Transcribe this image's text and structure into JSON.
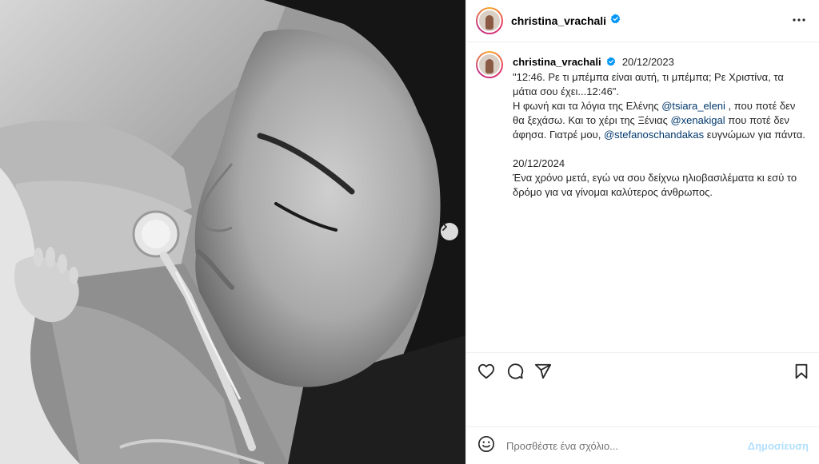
{
  "post": {
    "username": "christina_vrachali",
    "verified": true
  },
  "caption": {
    "username": "christina_vrachali",
    "date": "20/12/2023",
    "line1": "\"12:46. Ρε τι μπέμπα είναι αυτή, τι μπέμπα; Ρε Χριστίνα, τα μάτια σου έχει...12:46\".",
    "line2_pre": "Η φωνή και τα λόγια της Ελένης ",
    "mention1": "@tsiara_eleni",
    "line2_post": " , που ποτέ δεν θα  ξεχάσω. Και το χέρι της Ξένιας ",
    "mention2": "@xenakigal",
    "line2_post2": " που ποτέ δεν άφησα. Γιατρέ μου, ",
    "mention3": "@stefanoschandakas",
    "line2_end": " ευγνώμων για πάντα.",
    "date2": "20/12/2024",
    "line3": "Ένα χρόνο μετά, εγώ να σου δείχνω ηλιοβασιλέματα κι εσύ το δρόμο για να γίνομαι καλύτερος άνθρωπος."
  },
  "actions": {
    "like_icon": "heart-icon",
    "comment_icon": "comment-icon",
    "share_icon": "send-icon",
    "save_icon": "bookmark-icon"
  },
  "comment": {
    "placeholder": "Προσθέστε ένα σχόλιο...",
    "post_label": "Δημοσίευση"
  },
  "colors": {
    "verified": "#0095f6",
    "mention": "#00376b",
    "post_disabled": "#b2dffc"
  }
}
